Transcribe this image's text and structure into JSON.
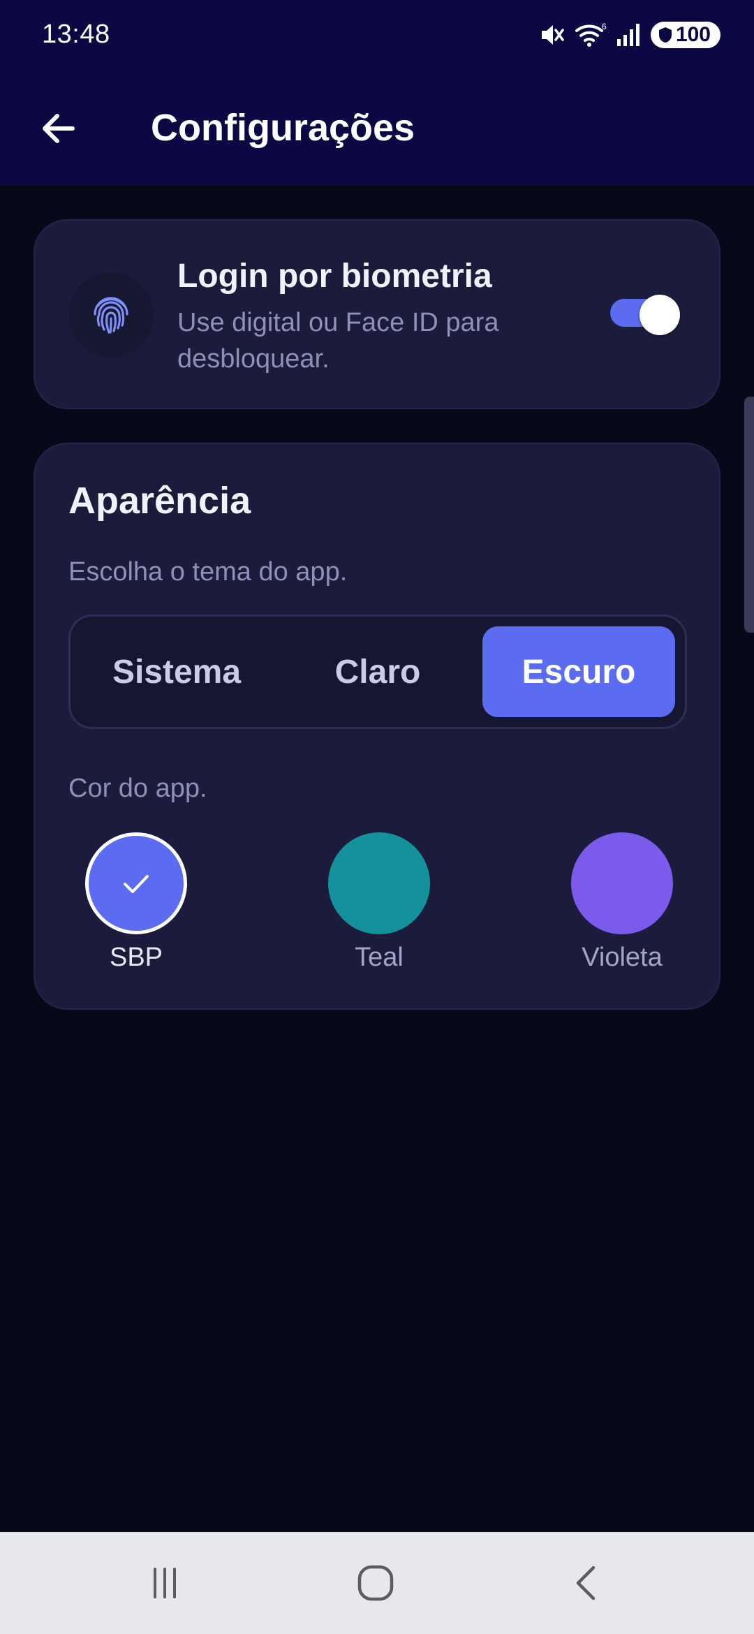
{
  "status_bar": {
    "time": "13:48",
    "battery": "100",
    "icons": [
      "mute-icon",
      "wifi-icon",
      "signal-icon",
      "battery-icon"
    ]
  },
  "app_bar": {
    "title": "Configurações",
    "back_icon": "arrow-left-icon"
  },
  "biometric": {
    "title": "Login por biometria",
    "subtitle": "Use digital ou Face ID para desbloquear.",
    "icon": "fingerprint-icon",
    "enabled": true
  },
  "appearance": {
    "title": "Aparência",
    "theme_label": "Escolha o tema do app.",
    "themes": [
      "Sistema",
      "Claro",
      "Escuro"
    ],
    "selected_theme": "Escuro",
    "color_label": "Cor do app.",
    "colors": [
      {
        "name": "SBP",
        "hex": "#5b6cf0",
        "selected": true
      },
      {
        "name": "Teal",
        "hex": "#14919b",
        "selected": false
      },
      {
        "name": "Violeta",
        "hex": "#7b5aec",
        "selected": false
      }
    ]
  },
  "nav_bar": {
    "buttons": [
      "recent-apps-icon",
      "home-icon",
      "back-icon"
    ]
  },
  "colors": {
    "app_bar": "#0c0844",
    "background": "#070818",
    "card": "#1b1c3c",
    "accent": "#5b6cf0"
  }
}
